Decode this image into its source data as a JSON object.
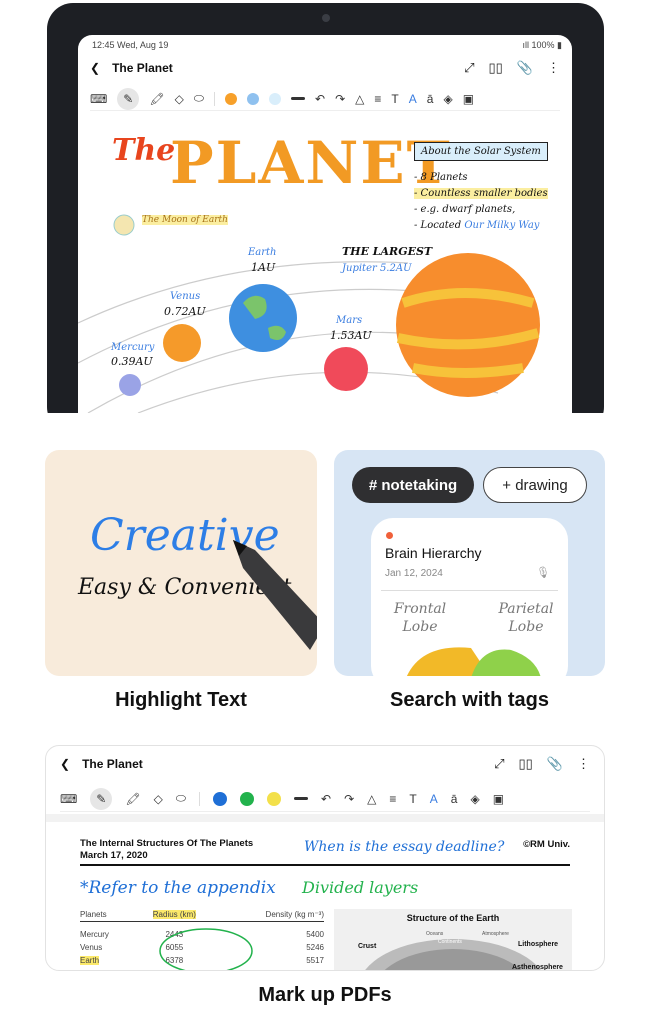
{
  "tablet": {
    "status": {
      "time": "12:45 Wed, Aug 19",
      "battery": "100%"
    },
    "title": "The Planet",
    "colors": [
      "#f7a02a",
      "#8fc1ef",
      "#d9eefb"
    ],
    "note": {
      "heading_the": "The",
      "heading_planet": "PLANET",
      "box_title": "About the Solar System",
      "bullets": [
        "- 8 Planets",
        "- Countless smaller bodies",
        "- e.g. dwarf planets,",
        "- Located "
      ],
      "bullet_link": "Our Milky Way",
      "moon": "The Moon of Earth",
      "largest": "THE LARGEST",
      "jupiter": "Jupiter 5.2AU",
      "earth": "Earth",
      "earth_au": "1AU",
      "venus": "Venus",
      "venus_au": "0.72AU",
      "mercury": "Mercury",
      "mercury_au": "0.39AU",
      "mars": "Mars",
      "mars_au": "1.53AU"
    }
  },
  "features": [
    {
      "caption": "Highlight Text",
      "word1": "Creative",
      "word2": "Easy & Convenient"
    },
    {
      "caption": "Search with tags",
      "tags": [
        "# notetaking",
        "+ drawing"
      ],
      "note_title": "Brain Hierarchy",
      "note_date": "Jan 12, 2024",
      "left_lobe": "Frontal Lobe",
      "right_lobe": "Parietal Lobe"
    }
  ],
  "pdf": {
    "title": "The Planet",
    "colors": [
      "#1f6fd6",
      "#22b24c",
      "#f3e04a"
    ],
    "doc_title": "The Internal Structures Of The Planets",
    "doc_date": "March 17, 2020",
    "copyright": "©RM Univ.",
    "note_deadline": "When is the essay deadline?",
    "note_appendix": "*Refer to the appendix",
    "note_layers": "Divided layers",
    "table": {
      "headers": [
        "Planets",
        "Radius (km)",
        "Density (kg m⁻³)"
      ],
      "rows": [
        [
          "Mercury",
          "2443",
          "5400"
        ],
        [
          "Venus",
          "6055",
          "5246"
        ],
        [
          "Earth",
          "6378",
          "5517"
        ]
      ]
    },
    "figure": {
      "title": "Structure of the Earth",
      "labels": [
        "Oceans",
        "Continents",
        "Atmosphere",
        "Crust",
        "Lithosphere",
        "Asthenosphere"
      ]
    },
    "caption": "Mark up PDFs"
  }
}
